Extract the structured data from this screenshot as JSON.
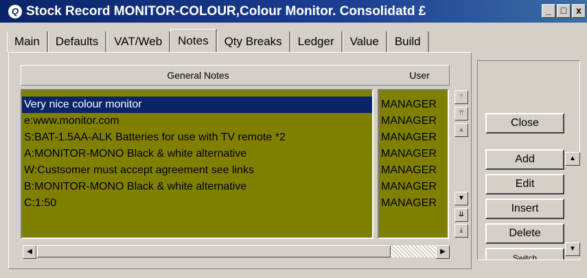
{
  "window": {
    "icon_glyph": "Q",
    "title": "Stock Record MONITOR-COLOUR,Colour Monitor. Consolidatd £",
    "controls": [
      {
        "name": "minimize-icon",
        "glyph": "_"
      },
      {
        "name": "maximize-icon",
        "glyph": "□"
      },
      {
        "name": "close-icon",
        "glyph": "x"
      }
    ]
  },
  "tabs": [
    {
      "label": "Main",
      "active": false
    },
    {
      "label": "Defaults",
      "active": false
    },
    {
      "label": "VAT/Web",
      "active": false
    },
    {
      "label": "Notes",
      "active": true
    },
    {
      "label": "Qty Breaks",
      "active": false
    },
    {
      "label": "Ledger",
      "active": false
    },
    {
      "label": "Value",
      "active": false
    },
    {
      "label": "Build",
      "active": false
    }
  ],
  "list": {
    "headers": {
      "notes": "General Notes",
      "user": "User"
    },
    "rows": [
      {
        "note": "Very nice colour monitor",
        "user": "MANAGER",
        "selected": true
      },
      {
        "note": "e:www.monitor.com",
        "user": "MANAGER",
        "selected": false
      },
      {
        "note": "S:BAT-1.5AA-ALK  Batteries for use with TV remote *2",
        "user": "MANAGER",
        "selected": false
      },
      {
        "note": "A:MONITOR-MONO Black & white alternative",
        "user": "MANAGER",
        "selected": false
      },
      {
        "note": "W:Custsomer must accept agreement see links",
        "user": "MANAGER",
        "selected": false
      },
      {
        "note": "B:MONITOR-MONO Black & white alternative",
        "user": "MANAGER",
        "selected": false
      },
      {
        "note": "C:1:50",
        "user": "MANAGER",
        "selected": false
      }
    ]
  },
  "scroll_glyphs": {
    "top": "⤒",
    "page_up": "⇈",
    "up": "▲",
    "down": "▼",
    "page_down": "⇊",
    "bottom": "⤓",
    "left": "◀",
    "right": "▶"
  },
  "buttons": {
    "close": {
      "label": "Close",
      "hotkey": "l"
    },
    "add": {
      "label": "Add",
      "hotkey": "A"
    },
    "edit": {
      "label": "Edit",
      "hotkey": "E"
    },
    "insert": {
      "label": "Insert",
      "hotkey": "I"
    },
    "delete": {
      "label": "Delete",
      "hotkey": "D"
    },
    "partial": {
      "label": "Switch"
    }
  },
  "colors": {
    "panel_bg": "#808000",
    "selection_bg": "#0a246a",
    "window_bg": "#d4d0c8"
  }
}
